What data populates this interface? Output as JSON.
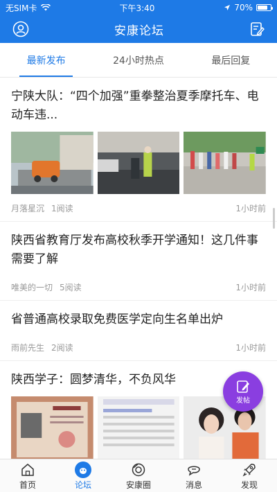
{
  "status": {
    "carrier": "无SIM卡",
    "time": "下午3:40",
    "battery": "70%"
  },
  "nav": {
    "title": "安康论坛"
  },
  "tabs": [
    {
      "label": "最新发布"
    },
    {
      "label": "24小时热点"
    },
    {
      "label": "最后回复"
    }
  ],
  "posts": [
    {
      "title": "宁陕大队：“四个加强”重拳整治夏季摩托车、电动车违...",
      "author": "月落星沉",
      "reads": "1阅读",
      "time": "1小时前"
    },
    {
      "title": "陕西省教育厅发布高校秋季开学通知！这几件事需要了解",
      "author": "唯美的一切",
      "reads": "5阅读",
      "time": "1小时前"
    },
    {
      "title": "省普通高校录取免费医学定向生名单出炉",
      "author": "雨前先生",
      "reads": "2阅读",
      "time": "1小时前"
    },
    {
      "title": "陕西学子：圆梦清华，不负风华"
    }
  ],
  "fab": {
    "label": "发帖"
  },
  "bottom_nav": [
    {
      "label": "首页"
    },
    {
      "label": "论坛"
    },
    {
      "label": "安康圈"
    },
    {
      "label": "消息"
    },
    {
      "label": "发现"
    }
  ],
  "colors": {
    "primary": "#1e7ae6",
    "fab": "#8a3ee0"
  }
}
